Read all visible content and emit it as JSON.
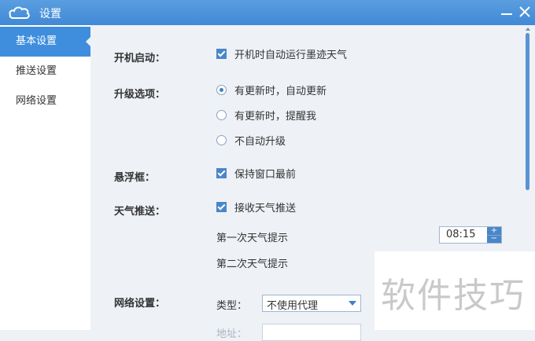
{
  "window": {
    "title": "设置"
  },
  "sidebar": {
    "items": [
      {
        "label": "基本设置",
        "active": true
      },
      {
        "label": "推送设置",
        "active": false
      },
      {
        "label": "网络设置",
        "active": false
      }
    ]
  },
  "startup": {
    "label": "开机启动：",
    "option": "开机时自动运行墨迹天气",
    "checked": true
  },
  "upgrade": {
    "label": "升级选项：",
    "options": [
      {
        "label": "有更新时，自动更新",
        "selected": true
      },
      {
        "label": "有更新时，提醒我",
        "selected": false
      },
      {
        "label": "不自动升级",
        "selected": false
      }
    ]
  },
  "float_window": {
    "label": "悬浮框：",
    "option": "保持窗口最前",
    "checked": true
  },
  "push": {
    "label": "天气推送：",
    "option": "接收天气推送",
    "checked": true,
    "first_label": "第一次天气提示",
    "first_time": "08:15",
    "second_label": "第二次天气提示"
  },
  "network": {
    "label": "网络设置：",
    "type_label": "类型：",
    "type_value": "不使用代理",
    "address_label": "地址："
  },
  "watermark": {
    "text": "软件技巧"
  },
  "colors": {
    "accent": "#3f8ede",
    "titlebar": "#4a90dc",
    "background": "#eef1f6"
  }
}
